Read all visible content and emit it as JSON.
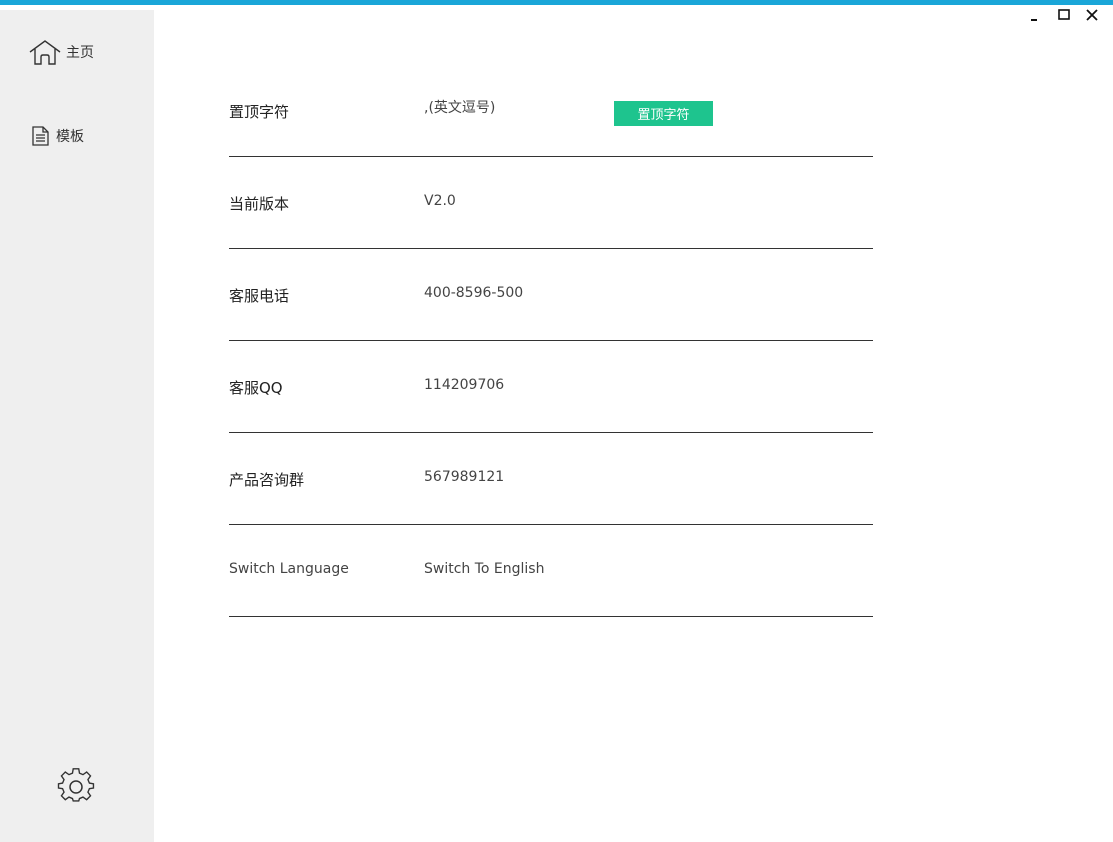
{
  "window": {
    "accent_color": "#1aa6d8",
    "controls": [
      "minimize-icon",
      "maximize-icon",
      "close-icon"
    ]
  },
  "sidebar": {
    "background": "#efefef",
    "items": [
      {
        "label": "主页",
        "icon": "home-icon"
      },
      {
        "label": "模板",
        "icon": "document-icon"
      }
    ],
    "settings_icon": "gear-icon"
  },
  "settings": {
    "rows": [
      {
        "label": "置顶字符",
        "input_value": ",(英文逗号)",
        "button_label": "置顶字符",
        "button_color": "#1ec48e"
      },
      {
        "label": "当前版本",
        "value": "V2.0"
      },
      {
        "label": "客服电话",
        "value": "400-8596-500"
      },
      {
        "label": "客服QQ",
        "value": "114209706"
      },
      {
        "label": "产品咨询群",
        "value": "567989121"
      },
      {
        "label": "Switch Language",
        "value": "Switch To English"
      }
    ]
  }
}
